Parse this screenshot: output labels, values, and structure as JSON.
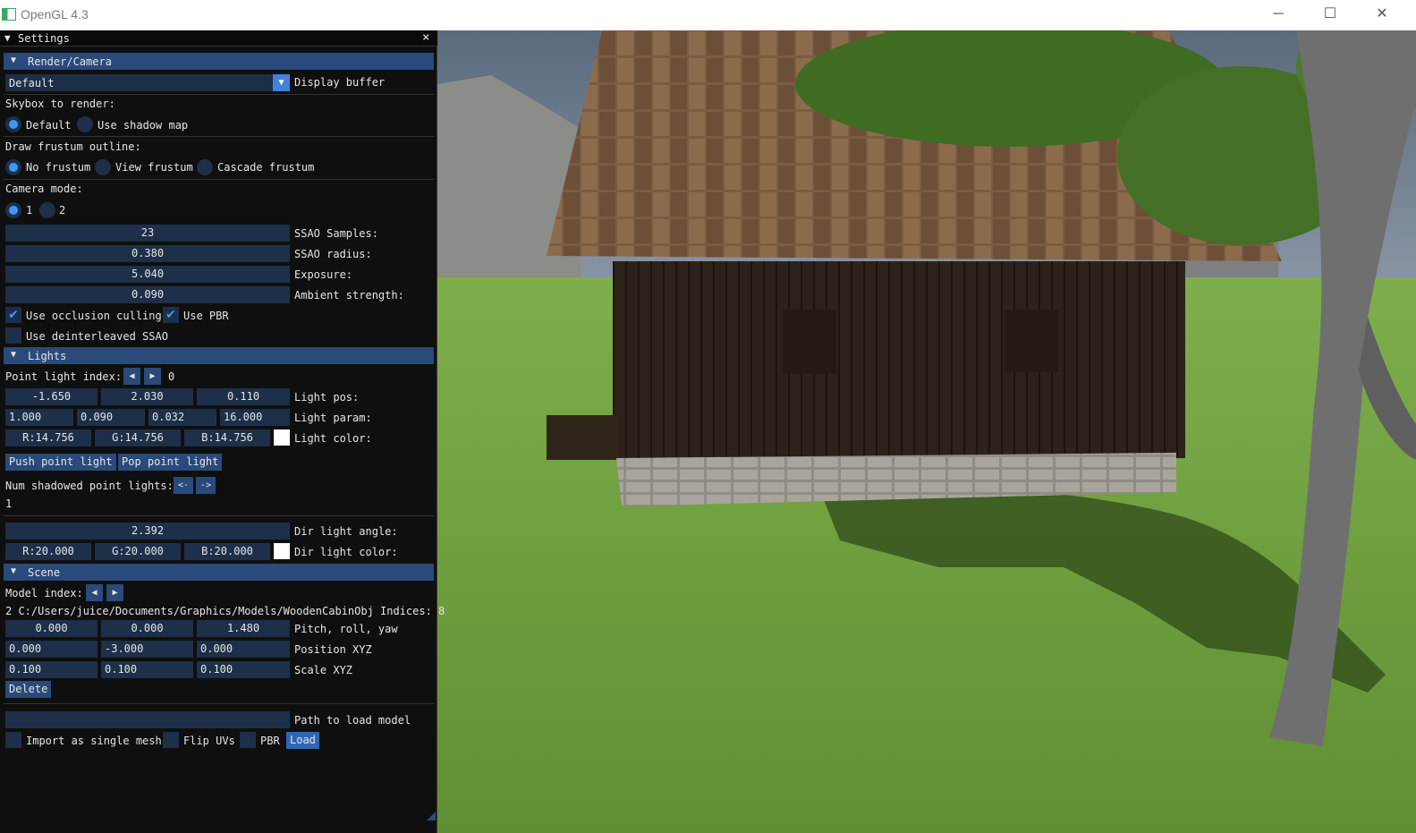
{
  "window": {
    "title": "OpenGL 4.3",
    "controls": [
      "─",
      "☐",
      "✕"
    ]
  },
  "panel": {
    "title": "Settings",
    "close_glyph": "×",
    "render_camera": {
      "header": "Render/Camera",
      "display_buffer": {
        "value": "Default",
        "label": "Display buffer"
      },
      "skybox": {
        "label": "Skybox to render:",
        "options": [
          "Default",
          "Use shadow map"
        ],
        "selected": "Default"
      },
      "frustum": {
        "label": "Draw frustum outline:",
        "options": [
          "No frustum",
          "View frustum",
          "Cascade frustum"
        ],
        "selected": "No frustum"
      },
      "camera_mode": {
        "label": "Camera mode:",
        "options": [
          "1",
          "2"
        ],
        "selected": "1"
      },
      "ssao_samples": {
        "value": "23",
        "label": "SSAO Samples:"
      },
      "ssao_radius": {
        "value": "0.380",
        "label": "SSAO radius:"
      },
      "exposure": {
        "value": "5.040",
        "label": "Exposure:"
      },
      "ambient": {
        "value": "0.090",
        "label": "Ambient strength:"
      },
      "occlusion_culling": {
        "label": "Use occlusion culling",
        "checked": true
      },
      "use_pbr": {
        "label": "Use PBR",
        "checked": true
      },
      "deinterleaved_ssao": {
        "label": "Use deinterleaved SSAO",
        "checked": false
      }
    },
    "lights": {
      "header": "Lights",
      "point_light_index": {
        "label": "Point light index:",
        "value": "0"
      },
      "light_pos": {
        "values": [
          "-1.650",
          "2.030",
          "0.110"
        ],
        "label": "Light pos:"
      },
      "light_param": {
        "values": [
          "1.000",
          "0.090",
          "0.032",
          "16.000"
        ],
        "label": "Light param:"
      },
      "light_color": {
        "values": [
          "R:14.756",
          "G:14.756",
          "B:14.756"
        ],
        "label": "Light color:",
        "swatch": "#ffffff"
      },
      "push_button": "Push point light",
      "pop_button": "Pop point light",
      "num_shadowed": {
        "label": "Num shadowed point lights:",
        "dec": "<-",
        "inc": "->",
        "value": "1"
      },
      "dir_angle": {
        "value": "2.392",
        "label": "Dir light angle:"
      },
      "dir_color": {
        "values": [
          "R:20.000",
          "G:20.000",
          "B:20.000"
        ],
        "label": "Dir light color:",
        "swatch": "#ffffff"
      }
    },
    "scene": {
      "header": "Scene",
      "model_index": {
        "label": "Model index:"
      },
      "model_info": "2  C:/Users/juice/Documents/Graphics/Models/WoodenCabinObj Indices: 8",
      "rotation": {
        "values": [
          "0.000",
          "0.000",
          "1.480"
        ],
        "label": "Pitch, roll, yaw"
      },
      "position": {
        "values": [
          "0.000",
          "-3.000",
          "0.000"
        ],
        "label": "Position XYZ"
      },
      "scale": {
        "values": [
          "0.100",
          "0.100",
          "0.100"
        ],
        "label": "Scale XYZ"
      },
      "delete_button": "Delete",
      "load_path": {
        "value": "",
        "label": "Path to load model"
      },
      "single_mesh": {
        "label": "Import as single mesh",
        "checked": false
      },
      "flip_uvs": {
        "label": "Flip UVs",
        "checked": false
      },
      "pbr": {
        "label": "PBR",
        "checked": false
      },
      "load_button": "Load"
    }
  },
  "colors": {
    "accent": "#4296fa",
    "header": "#294a7a",
    "frame": "#1d2f49",
    "panel_bg": "#0f0f0f"
  }
}
